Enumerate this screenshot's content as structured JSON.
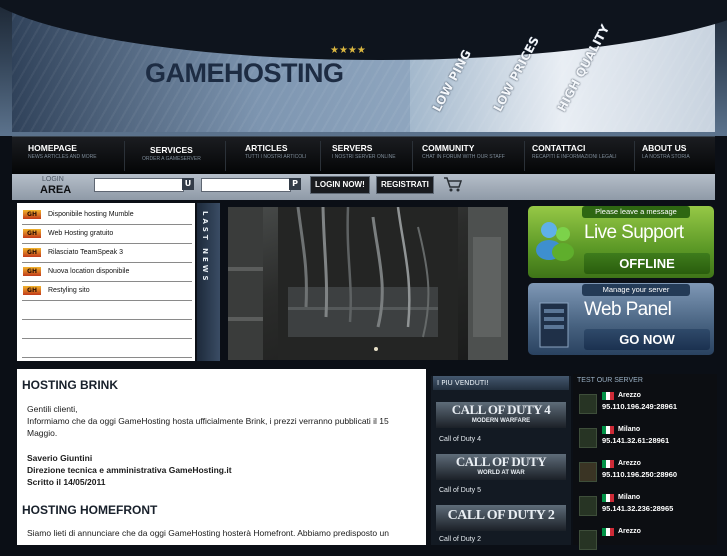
{
  "header": {
    "logo": "GAMEHOSTING",
    "stars": "★★★★",
    "slogans": [
      "LOW PING",
      "LOW PRICES",
      "HIGH QUALITY"
    ]
  },
  "nav": [
    {
      "label": "HOMEPAGE",
      "sub": "NEWS ARTICLES AND MORE"
    },
    {
      "label": "SERVICES",
      "sub": "ORDER A GAMESERVER"
    },
    {
      "label": "ARTICLES",
      "sub": "TUTTI I NOSTRI ARTICOLI"
    },
    {
      "label": "SERVERS",
      "sub": "I NOSTRI SERVER ONLINE"
    },
    {
      "label": "COMMUNITY",
      "sub": "CHAT IN FORUM WITH OUR STAFF"
    },
    {
      "label": "CONTATTACI",
      "sub": "RECAPITI E INFORMAZIONI LEGALI"
    },
    {
      "label": "ABOUT US",
      "sub": "LA NOSTRA STORIA"
    }
  ],
  "login": {
    "label_top": "LOGIN",
    "label_bottom": "AREA",
    "user_btn": "U",
    "pass_btn": "P",
    "login_btn": "LOGIN NOW!",
    "register_btn": "REGISTRATI",
    "cart_icon": "shopping-cart-icon"
  },
  "news": {
    "items": [
      "Disponibile hosting Mumble",
      "Web Hosting gratuito",
      "Rilasciato TeamSpeak 3",
      "Nuova location disponibile",
      "Restyling sito"
    ],
    "side_label": "LAST NEWS"
  },
  "banners": {
    "support_header": "Please leave a message",
    "support_title": "Live Support",
    "support_status": "OFFLINE",
    "panel_header": "Manage your server",
    "panel_title": "Web Panel",
    "panel_btn": "GO NOW"
  },
  "articles": [
    {
      "title": "HOSTING BRINK",
      "lines": [
        "Gentili clienti,",
        "Informiamo che da oggi GameHosting hosta ufficialmente Brink, i prezzi verranno pubblicati il 15",
        "Maggio."
      ],
      "author": "Saverio Giuntini",
      "role": "Direzione tecnica e amministrativa GameHosting.it",
      "date": "Scritto il 14/05/2011"
    },
    {
      "title": "HOSTING HOMEFRONT",
      "lines": [
        "Siamo lieti di annunciare che da oggi GameHosting hosterà Homefront. Abbiamo predisposto un"
      ]
    }
  ],
  "bestsellers": {
    "title": "I PIU VENDUTI!",
    "items": [
      {
        "logo": "CALL OF DUTY 4",
        "logo_sub": "MODERN WARFARE",
        "name": "Call of Duty 4"
      },
      {
        "logo": "CALL OF DUTY",
        "logo_sub": "WORLD AT WAR",
        "name": "Call of Duty 5"
      },
      {
        "logo": "CALL OF DUTY 2",
        "logo_sub": "",
        "name": "Call of Duty 2"
      }
    ]
  },
  "testserver": {
    "title": "TEST OUR SERVER",
    "servers": [
      {
        "city": "Arezzo",
        "ip": "95.110.196.249:28961"
      },
      {
        "city": "Milano",
        "ip": "95.141.32.61:28961"
      },
      {
        "city": "Arezzo",
        "ip": "95.110.196.250:28960"
      },
      {
        "city": "Milano",
        "ip": "95.141.32.236:28965"
      },
      {
        "city": "Arezzo",
        "ip": ""
      }
    ]
  }
}
